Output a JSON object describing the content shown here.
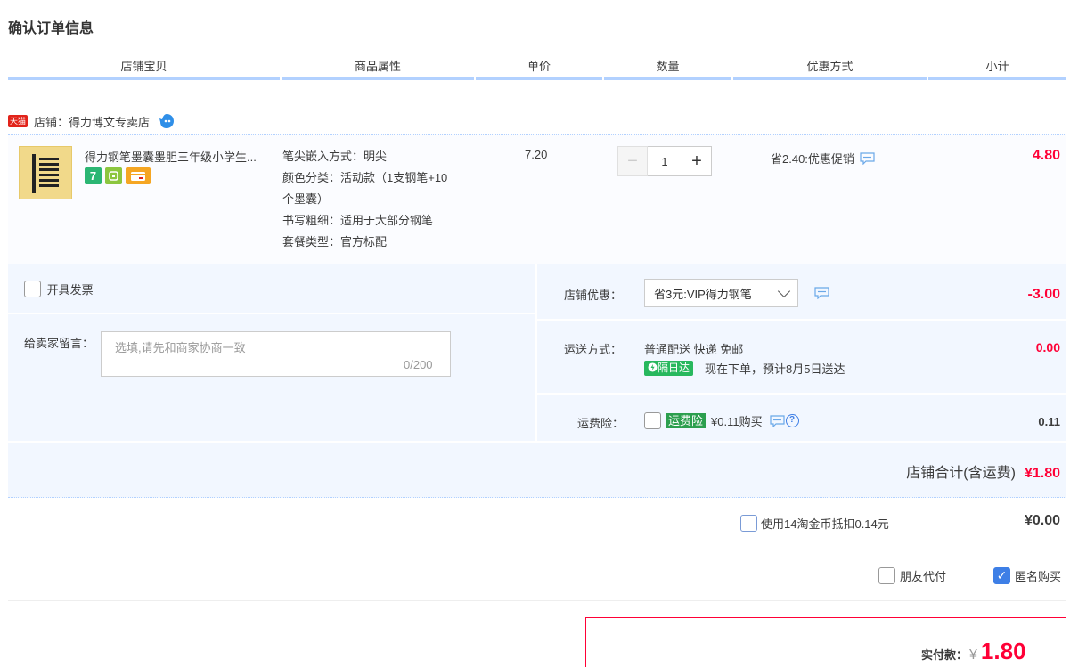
{
  "page_title": "确认订单信息",
  "columns": [
    "店铺宝贝",
    "商品属性",
    "单价",
    "数量",
    "优惠方式",
    "小计"
  ],
  "shop": {
    "tmall_badge": "天猫",
    "label": "店铺：得力博文专卖店"
  },
  "item": {
    "title": "得力钢笔墨囊墨胆三年级小学生...",
    "badge_7": "7",
    "props": [
      "笔尖嵌入方式：明尖",
      "颜色分类：活动款（1支钢笔+10",
      "个墨囊）",
      "书写粗细：适用于大部分钢笔",
      "套餐类型：官方标配"
    ],
    "price": "7.20",
    "quantity": "1",
    "promo": "省2.40:优惠促销",
    "subtotal": "4.80"
  },
  "options": {
    "invoice_label": "开具发票",
    "message_label": "给卖家留言：",
    "message_placeholder": "选填,请先和商家协商一致",
    "message_count": "0/200",
    "shop_discount_label": "店铺优惠：",
    "shop_discount_value": "省3元:VIP得力钢笔",
    "shop_discount_amount": "-3.00",
    "shipping_label": "运送方式：",
    "shipping_value": "普通配送 快递 免邮",
    "shipping_tag": "隔日达",
    "shipping_eta": "现在下单，预计8月5日送达",
    "shipping_amount": "0.00",
    "insurance_label": "运费险：",
    "insurance_tag": "运费险",
    "insurance_value": "¥0.11购买",
    "insurance_amount": "0.11",
    "shop_total_label": "店铺合计(含运费)",
    "shop_total": "¥1.80"
  },
  "coins": {
    "label": "使用14淘金币抵扣0.14元",
    "amount": "¥0.00"
  },
  "pay_options": {
    "friend_pay": "朋友代付",
    "anonymous": "匿名购买"
  },
  "payment": {
    "label": "实付款：",
    "currency": "¥",
    "amount": "1.80"
  },
  "colors": {
    "accent_red": "#ff0036",
    "accent_blue": "#3e7fe6",
    "header_line": "#b2d1ff"
  }
}
